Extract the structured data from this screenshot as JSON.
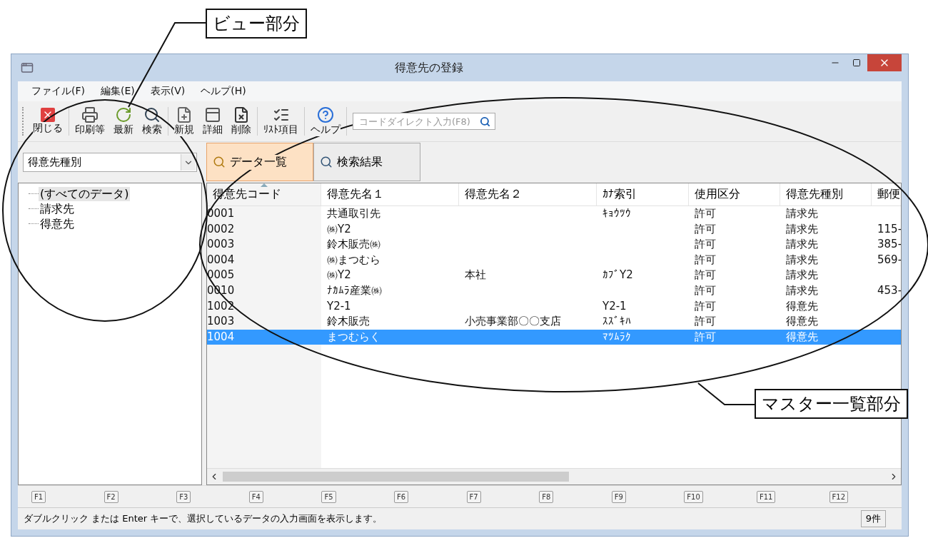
{
  "window": {
    "title": "得意先の登録"
  },
  "menu": [
    "ファイル(F)",
    "編集(E)",
    "表示(V)",
    "ヘルプ(H)"
  ],
  "toolbar": [
    {
      "label": "閉じる",
      "kind": "close"
    },
    {
      "label": "印刷等",
      "kind": "print"
    },
    {
      "label": "最新",
      "kind": "refresh"
    },
    {
      "label": "検索",
      "kind": "search"
    },
    {
      "label": "新規",
      "kind": "new"
    },
    {
      "label": "詳細",
      "kind": "detail"
    },
    {
      "label": "削除",
      "kind": "delete"
    },
    {
      "label": "ﾘｽﾄ項目",
      "kind": "list"
    },
    {
      "label": "ヘルプ",
      "kind": "help"
    }
  ],
  "code_search": {
    "placeholder": "コードダイレクト入力(F8)"
  },
  "view_select": {
    "value": "得意先種別"
  },
  "tree": [
    {
      "label": "(すべてのデータ)",
      "selected": true
    },
    {
      "label": "請求先",
      "selected": false
    },
    {
      "label": "得意先",
      "selected": false
    }
  ],
  "tabs": [
    {
      "label": "データ一覧",
      "selected": true
    },
    {
      "label": "検索結果",
      "selected": false
    }
  ],
  "table": {
    "columns": [
      {
        "label": "得意先コード",
        "sorted": true
      },
      {
        "label": "得意先名１",
        "sorted": false
      },
      {
        "label": "得意先名２",
        "sorted": false
      },
      {
        "label": "ｶﾅ索引",
        "sorted": false
      },
      {
        "label": "使用区分",
        "sorted": false
      },
      {
        "label": "得意先種別",
        "sorted": false
      },
      {
        "label": "郵便",
        "sorted": false
      }
    ],
    "rows": [
      {
        "cells": [
          "0001",
          "共通取引先",
          "",
          "ｷｮｳﾂｳ",
          "許可",
          "請求先",
          ""
        ],
        "selected": false
      },
      {
        "cells": [
          "0002",
          "㈱Y2",
          "",
          "",
          "許可",
          "請求先",
          "115-"
        ],
        "selected": false
      },
      {
        "cells": [
          "0003",
          "鈴木販売㈱",
          "",
          "",
          "許可",
          "請求先",
          "385-"
        ],
        "selected": false
      },
      {
        "cells": [
          "0004",
          "㈱まつむら",
          "",
          "",
          "許可",
          "請求先",
          "569-"
        ],
        "selected": false
      },
      {
        "cells": [
          "0005",
          "㈱Y2",
          "本社",
          "ｶﾌﾞY2",
          "許可",
          "請求先",
          ""
        ],
        "selected": false
      },
      {
        "cells": [
          "0010",
          "ﾅｶﾑﾗ産業㈱",
          "",
          "",
          "許可",
          "請求先",
          "453-"
        ],
        "selected": false
      },
      {
        "cells": [
          "1002",
          "Y2-1",
          "",
          "Y2-1",
          "許可",
          "得意先",
          ""
        ],
        "selected": false
      },
      {
        "cells": [
          "1003",
          "鈴木販売",
          "小売事業部〇〇支店",
          "ｽｽﾞｷﾊ",
          "許可",
          "得意先",
          ""
        ],
        "selected": false
      },
      {
        "cells": [
          "1004",
          "まつむらく",
          "",
          "ﾏﾂﾑﾗｸ",
          "許可",
          "得意先",
          ""
        ],
        "selected": true
      }
    ]
  },
  "function_keys": [
    "F1",
    "F2",
    "F3",
    "F4",
    "F5",
    "F6",
    "F7",
    "F8",
    "F9",
    "F10",
    "F11",
    "F12"
  ],
  "status_bar": {
    "message": "ダブルクリック または Enter キーで、選択しているデータの入力画面を表示します。",
    "count": "9件"
  },
  "callouts": [
    {
      "label": "ビュー部分",
      "kind": "view"
    },
    {
      "label": "マスター一覧部分",
      "kind": "list"
    }
  ]
}
